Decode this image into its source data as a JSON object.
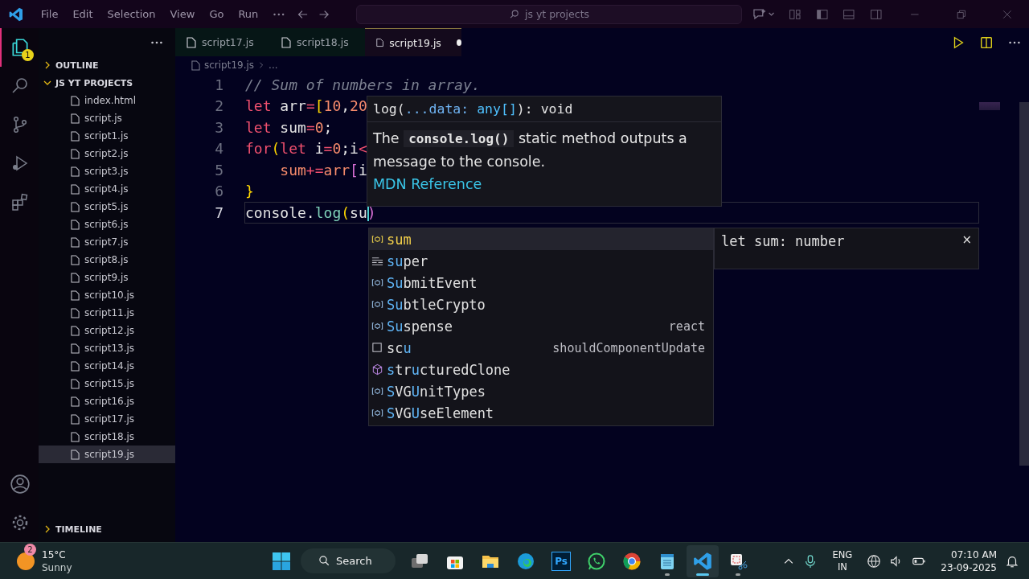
{
  "title_bar": {
    "menu": [
      "File",
      "Edit",
      "Selection",
      "View",
      "Go",
      "Run"
    ],
    "search": {
      "value": "js yt projects"
    }
  },
  "activity_bar": {
    "items": [
      {
        "kind": "explorer",
        "selected": true,
        "badge": "1"
      },
      {
        "kind": "search",
        "selected": false
      },
      {
        "kind": "source-control",
        "selected": false
      },
      {
        "kind": "run",
        "selected": false
      },
      {
        "kind": "extensions",
        "selected": false
      }
    ],
    "bottom": [
      {
        "kind": "account"
      },
      {
        "kind": "settings"
      }
    ]
  },
  "sidebar": {
    "sections": [
      {
        "title": "OUTLINE",
        "expanded": false
      },
      {
        "title": "JS YT PROJECTS",
        "expanded": true,
        "files": [
          {
            "name": "index.html",
            "selected": false
          },
          {
            "name": "script.js",
            "selected": false
          },
          {
            "name": "script1.js",
            "selected": false
          },
          {
            "name": "script2.js",
            "selected": false
          },
          {
            "name": "script3.js",
            "selected": false
          },
          {
            "name": "script4.js",
            "selected": false
          },
          {
            "name": "script5.js",
            "selected": false
          },
          {
            "name": "script6.js",
            "selected": false
          },
          {
            "name": "script7.js",
            "selected": false
          },
          {
            "name": "script8.js",
            "selected": false
          },
          {
            "name": "script9.js",
            "selected": false
          },
          {
            "name": "script10.js",
            "selected": false
          },
          {
            "name": "script11.js",
            "selected": false
          },
          {
            "name": "script12.js",
            "selected": false
          },
          {
            "name": "script13.js",
            "selected": false
          },
          {
            "name": "script14.js",
            "selected": false
          },
          {
            "name": "script15.js",
            "selected": false
          },
          {
            "name": "script16.js",
            "selected": false
          },
          {
            "name": "script17.js",
            "selected": false
          },
          {
            "name": "script18.js",
            "selected": false
          },
          {
            "name": "script19.js",
            "selected": true
          }
        ]
      },
      {
        "title": "TIMELINE",
        "expanded": false
      }
    ]
  },
  "tabs": [
    {
      "label": "script17.js",
      "selected": false,
      "modified": false
    },
    {
      "label": "script18.js",
      "selected": false,
      "modified": false
    },
    {
      "label": "script19.js",
      "selected": true,
      "modified": true
    }
  ],
  "breadcrumb": [
    "script19.js",
    "..."
  ],
  "editor": {
    "lines": [
      {
        "number": "1",
        "current": false,
        "tokens": [
          {
            "text": "// Sum of numbers in array.",
            "kind": "comment"
          }
        ]
      },
      {
        "number": "2",
        "current": false,
        "tokens": [
          {
            "text": "let",
            "kind": "keyword"
          },
          {
            "text": " arr",
            "kind": "plain"
          },
          {
            "text": "=",
            "kind": "operator"
          },
          {
            "text": "[",
            "kind": "bracket"
          },
          {
            "text": "10",
            "kind": "number"
          },
          {
            "text": ",",
            "kind": "plain"
          },
          {
            "text": "20",
            "kind": "number"
          }
        ]
      },
      {
        "number": "3",
        "current": false,
        "tokens": [
          {
            "text": "let",
            "kind": "keyword"
          },
          {
            "text": " sum",
            "kind": "plain"
          },
          {
            "text": "=",
            "kind": "operator"
          },
          {
            "text": "0",
            "kind": "number"
          },
          {
            "text": ";",
            "kind": "plain"
          }
        ]
      },
      {
        "number": "4",
        "current": false,
        "tokens": [
          {
            "text": "for",
            "kind": "keyword"
          },
          {
            "text": "(",
            "kind": "bracket"
          },
          {
            "text": "let",
            "kind": "keyword"
          },
          {
            "text": " i",
            "kind": "plain"
          },
          {
            "text": "=",
            "kind": "operator"
          },
          {
            "text": "0",
            "kind": "number"
          },
          {
            "text": ";i",
            "kind": "plain"
          },
          {
            "text": "<",
            "kind": "operator"
          }
        ]
      },
      {
        "number": "5",
        "current": false,
        "tokens": [
          {
            "text": "    sum",
            "kind": "variable"
          },
          {
            "text": "+=",
            "kind": "operator"
          },
          {
            "text": "arr",
            "kind": "variable"
          },
          {
            "text": "[",
            "kind": "bracket2"
          },
          {
            "text": "i",
            "kind": "plain"
          }
        ]
      },
      {
        "number": "6",
        "current": false,
        "tokens": [
          {
            "text": "}",
            "kind": "bracket"
          }
        ]
      },
      {
        "number": "7",
        "current": true,
        "tokens": [
          {
            "text": "console",
            "kind": "plain"
          },
          {
            "text": ".",
            "kind": "plain"
          },
          {
            "text": "log",
            "kind": "function"
          },
          {
            "text": "(",
            "kind": "bracket"
          },
          {
            "text": "su",
            "kind": "plain"
          },
          {
            "text": ")",
            "kind": "bracket2"
          }
        ]
      }
    ]
  },
  "hover": {
    "signature": [
      {
        "text": "log(",
        "kind": "plain"
      },
      {
        "text": "...data:",
        "kind": "param"
      },
      {
        "text": " any[]",
        "kind": "type"
      },
      {
        "text": "): void",
        "kind": "plain"
      }
    ],
    "description": [
      {
        "text": "The ",
        "code": false
      },
      {
        "text": "console.log()",
        "code": true
      },
      {
        "text": " static method outputs a message to the console.",
        "code": false
      }
    ],
    "link": "MDN Reference"
  },
  "suggest": {
    "items": [
      {
        "kind": "variable",
        "selected": true,
        "segments": [
          {
            "text": "sum",
            "match": true
          }
        ]
      },
      {
        "kind": "keyword",
        "selected": false,
        "segments": [
          {
            "text": "su",
            "match": true
          },
          {
            "text": "per",
            "match": false
          }
        ]
      },
      {
        "kind": "variable",
        "selected": false,
        "segments": [
          {
            "text": "Su",
            "match": true
          },
          {
            "text": "bmitEvent",
            "match": false
          }
        ]
      },
      {
        "kind": "variable",
        "selected": false,
        "segments": [
          {
            "text": "Su",
            "match": true
          },
          {
            "text": "btleCrypto",
            "match": false
          }
        ]
      },
      {
        "kind": "variable",
        "selected": false,
        "segments": [
          {
            "text": "Su",
            "match": true
          },
          {
            "text": "spense",
            "match": false
          }
        ],
        "detail": "react"
      },
      {
        "kind": "snippet",
        "selected": false,
        "segments": [
          {
            "text": "sc",
            "match": false
          },
          {
            "text": "u",
            "match": true
          }
        ],
        "detail": "shouldComponentUpdate"
      },
      {
        "kind": "function",
        "selected": false,
        "segments": [
          {
            "text": "s",
            "match": true
          },
          {
            "text": "tr",
            "match": false
          },
          {
            "text": "u",
            "match": true
          },
          {
            "text": "cturedClone",
            "match": false
          }
        ]
      },
      {
        "kind": "variable",
        "selected": false,
        "segments": [
          {
            "text": "S",
            "match": true
          },
          {
            "text": "VG",
            "match": false
          },
          {
            "text": "U",
            "match": true
          },
          {
            "text": "nitTypes",
            "match": false
          }
        ]
      },
      {
        "kind": "variable",
        "selected": false,
        "segments": [
          {
            "text": "S",
            "match": true
          },
          {
            "text": "VG",
            "match": false
          },
          {
            "text": "U",
            "match": true
          },
          {
            "text": "seElement",
            "match": false
          }
        ]
      }
    ],
    "details": {
      "text": "let sum: number",
      "close": "×"
    }
  },
  "taskbar": {
    "weather": {
      "temp": "15°C",
      "condition": "Sunny",
      "badge": "2"
    },
    "search": "Search",
    "apps": [
      {
        "kind": "task-view",
        "running": false,
        "selected": false
      },
      {
        "kind": "store",
        "running": false,
        "selected": false
      },
      {
        "kind": "folder",
        "running": false,
        "selected": false
      },
      {
        "kind": "edge",
        "running": false,
        "selected": false
      },
      {
        "kind": "photoshop",
        "label": "Ps",
        "running": false,
        "selected": false
      },
      {
        "kind": "whatsapp",
        "running": false,
        "selected": false
      },
      {
        "kind": "chrome",
        "running": false,
        "selected": false
      },
      {
        "kind": "notepad",
        "running": true,
        "selected": false
      },
      {
        "kind": "vscode",
        "running": true,
        "selected": true
      },
      {
        "kind": "snipping",
        "running": true,
        "selected": false
      }
    ],
    "tray": {
      "language": [
        "ENG",
        "IN"
      ],
      "time": "07:10 AM",
      "date": "23-09-2025"
    }
  }
}
